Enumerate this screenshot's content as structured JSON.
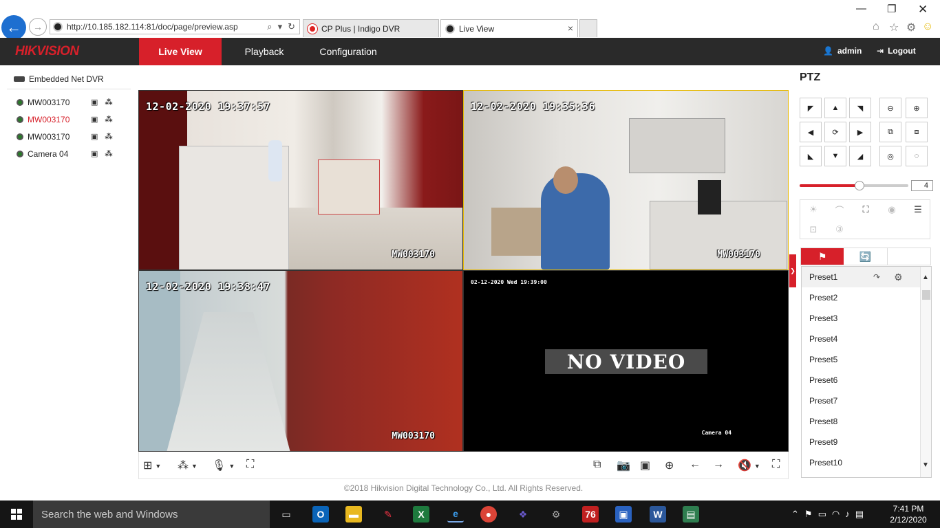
{
  "browser": {
    "url": "http://10.185.182.114:81/doc/page/preview.asp",
    "tabs": [
      {
        "title": "CP Plus | Indigo DVR"
      },
      {
        "title": "Live View"
      }
    ]
  },
  "header": {
    "logo": "HIKVISION",
    "nav": [
      {
        "label": "Live View",
        "active": true
      },
      {
        "label": "Playback"
      },
      {
        "label": "Configuration"
      }
    ],
    "user": "admin",
    "logout": "Logout"
  },
  "device_tree": {
    "root": "Embedded Net DVR",
    "cameras": [
      {
        "name": "MW003170",
        "active": false
      },
      {
        "name": "MW003170",
        "active": true
      },
      {
        "name": "MW003170",
        "active": false
      },
      {
        "name": "Camera 04",
        "active": false
      }
    ]
  },
  "tiles": [
    {
      "timestamp": "12-02-2020 19:37:57",
      "name": "MW003170"
    },
    {
      "timestamp": "12-02-2020 19:35:36",
      "name": "MW003170"
    },
    {
      "timestamp": "12-02-2020 19:38:47",
      "name": "MW003170"
    },
    {
      "timestamp": "02-12-2020 Wed 19:39:00",
      "name": "Camera 04",
      "status": "NO VIDEO"
    }
  ],
  "footer": {
    "copyright": "©2018 Hikvision Digital Technology Co., Ltd. All Rights Reserved."
  },
  "ptz": {
    "title": "PTZ",
    "speed": "4",
    "speed_fraction": 0.55,
    "presets": [
      "Preset1",
      "Preset2",
      "Preset3",
      "Preset4",
      "Preset5",
      "Preset6",
      "Preset7",
      "Preset8",
      "Preset9",
      "Preset10"
    ]
  },
  "taskbar": {
    "search_placeholder": "Search the web and Windows",
    "time": "7:41 PM",
    "date": "2/12/2020"
  },
  "colors": {
    "accent": "#d7202a",
    "header_bg": "#2a2a2a"
  }
}
